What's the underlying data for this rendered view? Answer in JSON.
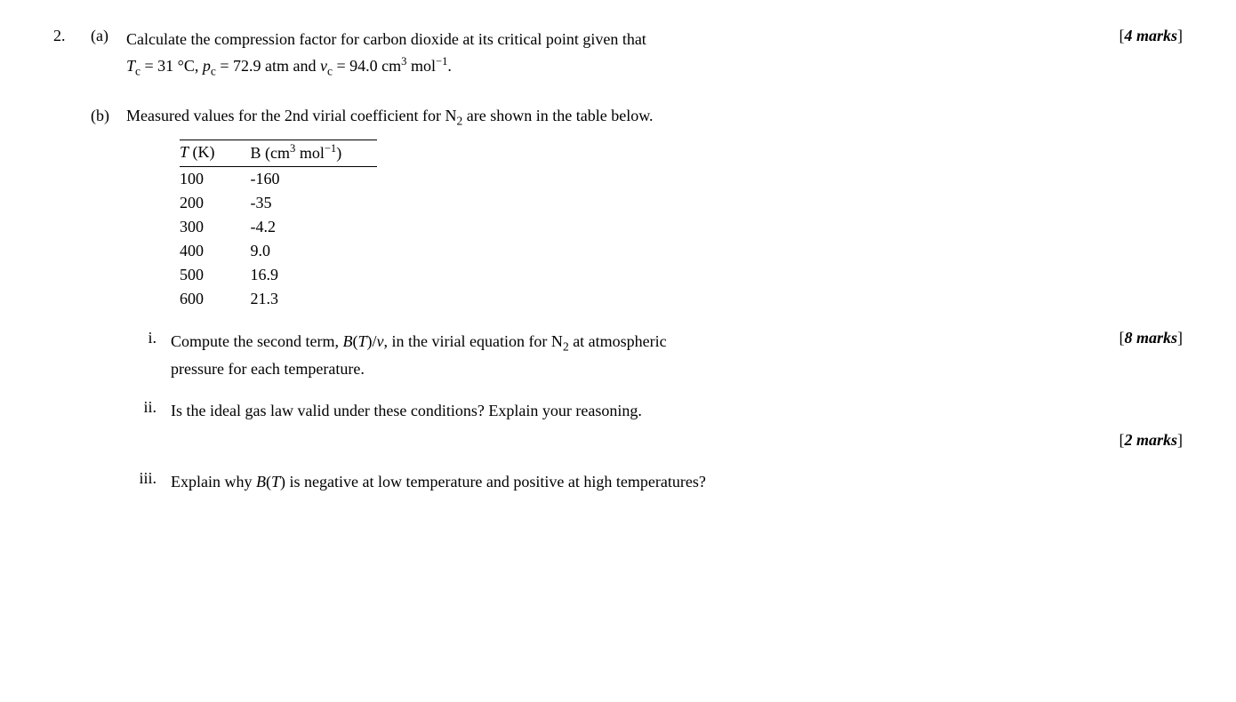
{
  "question": {
    "number": "2.",
    "part_a": {
      "label": "(a)",
      "text_line1": "Calculate the compression factor for carbon dioxide at its critical point given that",
      "text_line2_parts": [
        "T",
        "c",
        " = 31 °C, ",
        "p",
        "c",
        " = 72.9 atm and ",
        "v",
        "c",
        " = 94.0 cm",
        "3",
        " mol",
        "−1",
        "."
      ],
      "marks": "4 marks"
    },
    "part_b": {
      "label": "(b)",
      "text": "Measured values for the 2nd virial coefficient for N",
      "text_sub": "2",
      "text_end": " are shown in the table below.",
      "table": {
        "col1_header": "T (K)",
        "col2_header": "B (cm³ mol⁻¹)",
        "rows": [
          {
            "T": "100",
            "B": "-160"
          },
          {
            "T": "200",
            "B": "-35"
          },
          {
            "T": "300",
            "B": "-4.2"
          },
          {
            "T": "400",
            "B": "9.0"
          },
          {
            "T": "500",
            "B": "16.9"
          },
          {
            "T": "600",
            "B": "21.3"
          }
        ]
      },
      "sub_parts": {
        "i": {
          "label": "i.",
          "text_line1": "Compute the second term, ",
          "formula": "B(T)/v",
          "text_line2": ", in the virial equation for N",
          "text_sub": "2",
          "text_end": " at atmospheric",
          "text_line3": "pressure for each temperature.",
          "marks": "8 marks"
        },
        "ii": {
          "label": "ii.",
          "text": "Is the ideal gas law valid under these conditions?  Explain your reasoning.",
          "marks": "2 marks"
        },
        "iii": {
          "label": "iii.",
          "text": "Explain why B(T) is negative at low temperature and positive at high temperatures?"
        }
      }
    }
  }
}
